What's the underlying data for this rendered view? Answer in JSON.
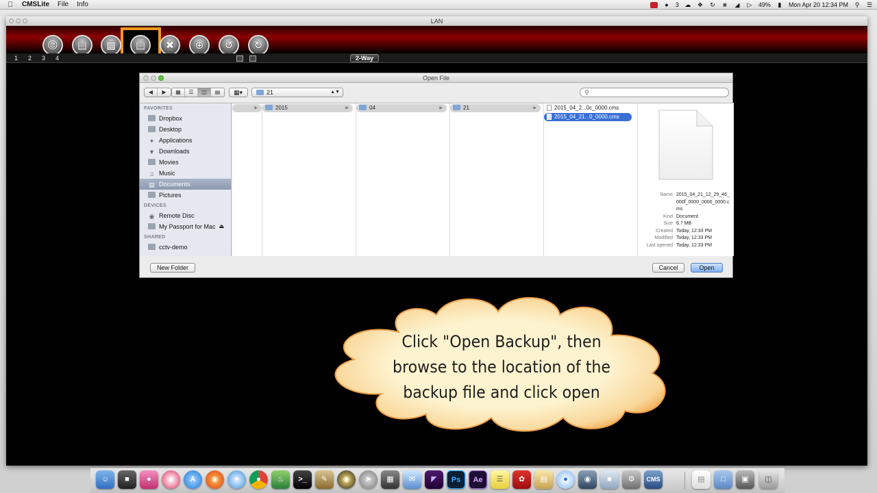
{
  "menubar": {
    "apple": "",
    "app_name": "CMSLite",
    "items": [
      "File",
      "Info"
    ],
    "status_right": {
      "notif_count": "3",
      "battery": "49%",
      "clock": "Mon Apr 20  12:34 PM"
    }
  },
  "cms_window": {
    "title": "LAN",
    "toolbar_icons": [
      "person-icon",
      "server-icon",
      "film-icon",
      "backup-icon",
      "tools-icon",
      "target-icon",
      "refresh-icon",
      "power-icon"
    ],
    "channel_numbers": [
      "1",
      "2",
      "3",
      "4"
    ],
    "mode_label": "2-Way",
    "accent_color": "#f0981c"
  },
  "dialog": {
    "title": "Open File",
    "location": "21",
    "search_placeholder": "",
    "sidebar": {
      "favorites_header": "FAVORITES",
      "favorites": [
        "Dropbox",
        "Desktop",
        "Applications",
        "Downloads",
        "Movies",
        "Music",
        "Documents",
        "Pictures"
      ],
      "selected": "Documents",
      "devices_header": "DEVICES",
      "devices": [
        "Remote Disc",
        "My Passport for Mac"
      ],
      "shared_header": "SHARED",
      "shared": [
        "cctv-demo"
      ]
    },
    "columns": {
      "col2": "2015",
      "col3": "04",
      "col4": "21",
      "files": [
        "2015_04_2...0c_0000.cms",
        "2015_04_21...0_0000.cms"
      ],
      "selected_file": "2015_04_21...0_0000.cms"
    },
    "preview": {
      "name_label": "Name",
      "name_value": "2015_04_21_12_29_46_000f_0000_0000_0000.cms",
      "kind_label": "Kind",
      "kind_value": "Document",
      "size_label": "Size",
      "size_value": "6.7 MB",
      "created_label": "Created",
      "created_value": "Today, 12:33 PM",
      "modified_label": "Modified",
      "modified_value": "Today, 12:33 PM",
      "opened_label": "Last opened",
      "opened_value": "Today, 12:33 PM"
    },
    "buttons": {
      "new_folder": "New Folder",
      "cancel": "Cancel",
      "open": "Open"
    }
  },
  "callout": {
    "lines": [
      "Click \"Open Backup\", then",
      "browse to the location of the",
      "backup file and click open"
    ],
    "fill_color": "#fdf3cf",
    "edge_color": "#f4a040"
  },
  "dock": {
    "apps": [
      "finder-icon",
      "photo-slideshow-icon",
      "photo-booth-icon",
      "itunes-icon",
      "app-store-icon",
      "firefox-icon",
      "safari-icon",
      "chrome-icon",
      "preview-icon",
      "terminal-icon",
      "utility-icon",
      "disc-icon",
      "rocket-icon",
      "calculator-icon",
      "mail-icon",
      "premiere-icon",
      "photoshop-icon",
      "after-effects-icon",
      "stickies-icon",
      "acrobat-icon",
      "preview2-icon",
      "messages-icon",
      "keynote-icon",
      "photos-icon",
      "system-prefs-icon",
      "cms-icon",
      "document-icon",
      "folder-icon",
      "file-stack-icon",
      "trash-icon"
    ],
    "photoshop_label": "Ps",
    "after_effects_label": "Ae",
    "cms_label": "CMS"
  }
}
